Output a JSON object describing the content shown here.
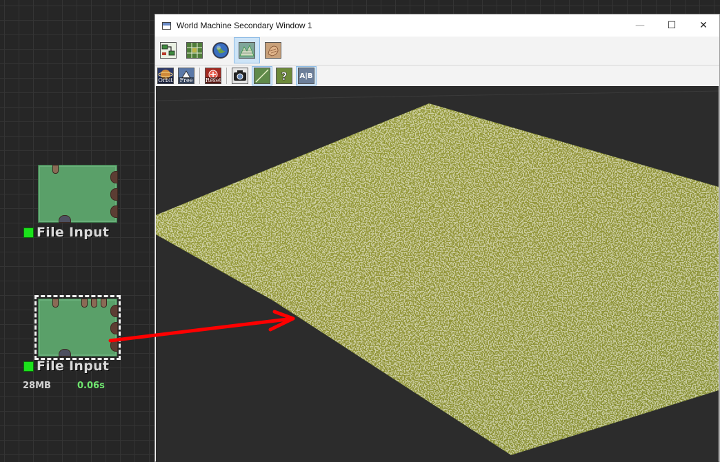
{
  "nodes": [
    {
      "label": "File Input",
      "status_color": "#1be21b",
      "selected": false
    },
    {
      "label": "File Input",
      "status_color": "#1be21b",
      "selected": true,
      "memory": "28MB",
      "time": "0.06s"
    }
  ],
  "connection": {
    "color": "#ff0000"
  },
  "window": {
    "title": "World Machine Secondary Window 1",
    "controls": {
      "minimize": "—",
      "maximize": "☐",
      "close": "✕"
    },
    "toolbar_row1": [
      {
        "name": "node-view",
        "icon": "flowchart-icon",
        "active": false
      },
      {
        "name": "layout-view",
        "icon": "map-grid-icon",
        "active": false
      },
      {
        "name": "globe-view",
        "icon": "globe-icon",
        "active": false
      },
      {
        "name": "3d-view",
        "icon": "terrain-icon",
        "active": true
      },
      {
        "name": "texture-view",
        "icon": "hand-texture-icon",
        "active": false
      }
    ],
    "toolbar_row2": [
      {
        "name": "orbit",
        "label": "Orbit",
        "icon": "orbit-icon",
        "active": false
      },
      {
        "name": "free",
        "label": "Free",
        "icon": "free-camera-icon",
        "active": false
      },
      {
        "name": "reset",
        "label": "Reset",
        "icon": "reset-icon",
        "active": false
      },
      {
        "name": "snapshot",
        "label": "",
        "icon": "camera-icon",
        "active": false
      },
      {
        "name": "wireframe",
        "label": "",
        "icon": "wireframe-icon",
        "active": true
      },
      {
        "name": "help",
        "label": "",
        "icon": "help-icon",
        "active": false
      },
      {
        "name": "ab-compare",
        "label": "A|B",
        "icon": "ab-compare-icon",
        "active": true
      }
    ]
  },
  "viewport": {
    "background": "#2c2c2c",
    "terrain_texture": "grass"
  }
}
